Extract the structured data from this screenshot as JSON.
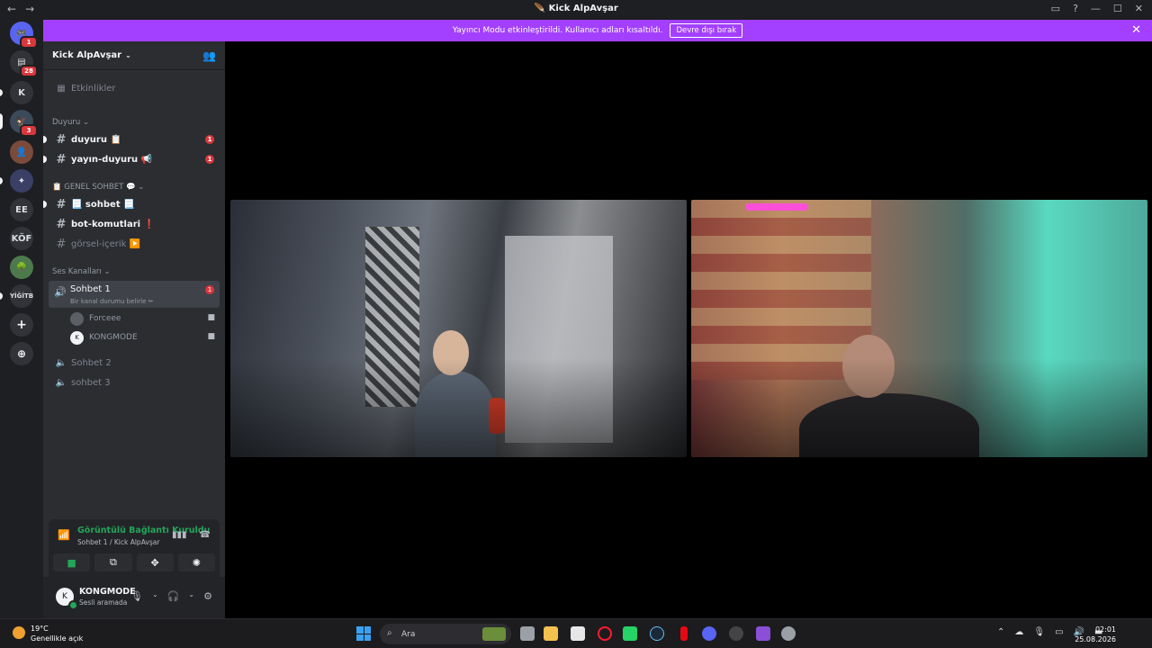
{
  "window": {
    "title": "Kick AlpAvşar",
    "back": "←",
    "forward": "→"
  },
  "banner": {
    "text": "Yayıncı Modu etkinleştirildi. Kullanıcı adları kısaltıldı.",
    "button": "Devre dışı bırak"
  },
  "guilds": [
    {
      "label": "",
      "icon": "discord-icon",
      "badge": "1"
    },
    {
      "label": "",
      "icon": "inbox-icon",
      "badge": "28"
    },
    {
      "label": "K",
      "badge": ""
    },
    {
      "label": "",
      "icon": "server-avatar-icon",
      "badge": "3"
    },
    {
      "label": "",
      "icon": "server-avatar-icon",
      "badge": ""
    },
    {
      "label": "",
      "icon": "server-avatar-icon",
      "badge": ""
    },
    {
      "label": "EE",
      "badge": ""
    },
    {
      "label": "KÖF",
      "badge": ""
    },
    {
      "label": "",
      "icon": "server-avatar-icon",
      "badge": ""
    },
    {
      "label": "YİĞİTB",
      "badge": ""
    },
    {
      "label": "+",
      "icon": "add-server-icon",
      "badge": ""
    },
    {
      "label": "⊕",
      "icon": "discover-icon",
      "badge": ""
    }
  ],
  "server": {
    "name": "Kick AlpAvşar",
    "events": "Etkinlikler"
  },
  "categories": {
    "duyuru": "Duyuru",
    "genel": "📋 GENEL SOHBET 💬",
    "ses": "Ses Kanalları"
  },
  "channels": {
    "duyuru": {
      "name": "duyuru 📋",
      "badge": "1"
    },
    "yayin": {
      "name": "yayın-duyuru 📢",
      "badge": "1"
    },
    "sohbet": {
      "name": "📃 sohbet 📃"
    },
    "bot": {
      "name": "bot-komutlari ❗"
    },
    "gorsel": {
      "name": "görsel-içerik ▶️"
    }
  },
  "voice": {
    "active": {
      "name": "Sohbet 1",
      "status": "Bir kanal durumu belirle ✏",
      "badge": "1"
    },
    "users": [
      {
        "name": "Forceee"
      },
      {
        "name": "KONGMODE"
      }
    ],
    "other": [
      {
        "name": "Sohbet 2"
      },
      {
        "name": "sohbet 3"
      }
    ]
  },
  "rtc": {
    "status": "Görüntülü Bağlantı Kuruldu",
    "location": "Sohbet 1 / Kick AlpAvşar"
  },
  "user": {
    "name": "KONGMODE",
    "status": "Sesli aramada",
    "avatar": "K"
  },
  "taskbar": {
    "temperature": "19°C",
    "weather": "Genellikle açık",
    "search": "Ara",
    "time": "02:01",
    "date": "25.08.2026"
  },
  "colors": {
    "accent": "#a340ff",
    "online": "#23a55a",
    "badge": "#da373c"
  }
}
